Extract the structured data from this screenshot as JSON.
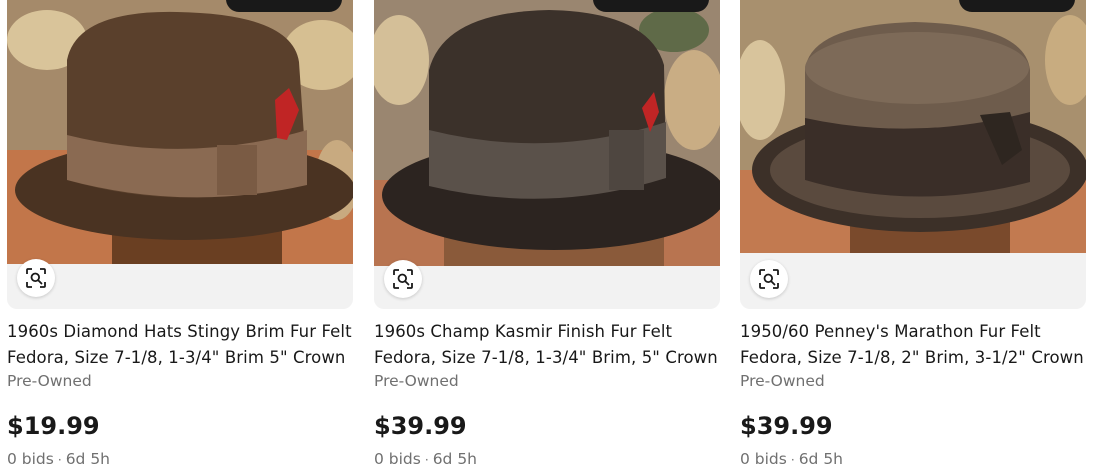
{
  "listings": [
    {
      "title": "1960s Diamond Hats Stingy Brim Fur Felt Fedora, Size 7-1/8, 1-3/4\" Brim 5\" Crown",
      "condition": "Pre-Owned",
      "price": "$19.99",
      "bids": "0 bids",
      "separator": "·",
      "time_left": "6d 5h",
      "image_icon": "visual-search-icon"
    },
    {
      "title": "1960s Champ Kasmir Finish Fur Felt Fedora, Size 7-1/8, 1-3/4\" Brim, 5\" Crown",
      "condition": "Pre-Owned",
      "price": "$39.99",
      "bids": "0 bids",
      "separator": "·",
      "time_left": "6d 5h",
      "image_icon": "visual-search-icon"
    },
    {
      "title": "1950/60 Penney's Marathon Fur Felt Fedora, Size 7-1/8, 2\" Brim, 3-1/2\" Crown",
      "condition": "Pre-Owned",
      "price": "$39.99",
      "bids": "0 bids",
      "separator": "·",
      "time_left": "6d 5h",
      "image_icon": "visual-search-icon"
    }
  ],
  "colors": {
    "text": "#191919",
    "secondary_text": "#707070",
    "image_background": "#f2f2f2"
  }
}
